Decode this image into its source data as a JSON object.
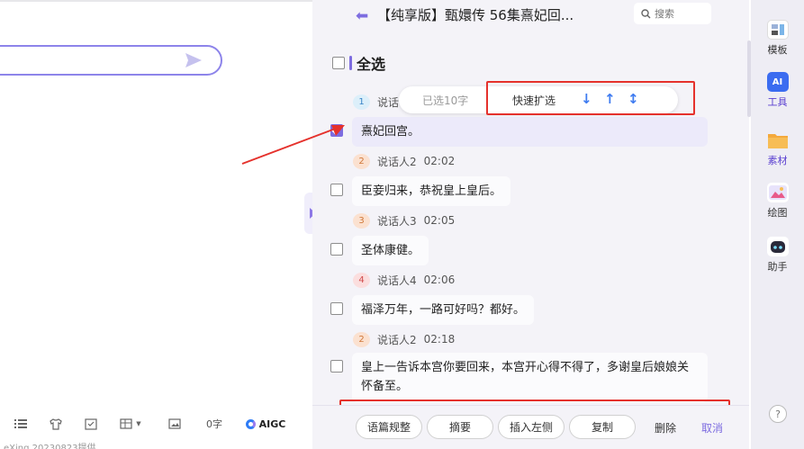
{
  "header": {
    "back_icon": "back-arrow-icon",
    "title": "【纯享版】甄嬛传 56集熹妃回...",
    "search_placeholder": "搜索"
  },
  "select_all_label": "全选",
  "selection_bar": {
    "selected_text": "已选10字",
    "expand_label": "快速扩选",
    "icons": [
      "arrow-down-icon",
      "arrow-up-icon",
      "arrow-updown-icon"
    ]
  },
  "utterances": [
    {
      "badge": "1",
      "speaker": "说话",
      "time": "",
      "text": "熹妃回宫。",
      "checked": true
    },
    {
      "badge": "2",
      "speaker": "说话人2",
      "time": "02:02",
      "text": "臣妾归来，恭祝皇上皇后。",
      "checked": false
    },
    {
      "badge": "3",
      "speaker": "说话人3",
      "time": "02:05",
      "text": "圣体康健。",
      "checked": false
    },
    {
      "badge": "4",
      "speaker": "说话人4",
      "time": "02:06",
      "text": "福泽万年，一路可好吗？都好。",
      "checked": false
    },
    {
      "badge": "2",
      "speaker": "说话人2",
      "time": "02:18",
      "text": "皇上一告诉本宫你要回来，本宫开心得不得了，多谢皇后娘娘关怀备至。",
      "checked": false
    }
  ],
  "badge_colors": {
    "1": "#dceffa",
    "2": "#fbe1d0",
    "3": "#fbe1d0",
    "4": "#fbdede"
  },
  "badge_text_colors": {
    "1": "#3a86c8",
    "2": "#d0783a",
    "3": "#d0783a",
    "4": "#d04a4a"
  },
  "actions": {
    "format": "语篇规整",
    "summary": "摘要",
    "insert_left": "插入左侧",
    "copy": "复制",
    "delete": "删除",
    "cancel": "取消"
  },
  "left_toolbar": {
    "word_count": "0字",
    "aigc_label": "AIGC",
    "footer_text": "eXing 20230823提供"
  },
  "rail": [
    {
      "icon": "template-icon",
      "label": "模板"
    },
    {
      "icon": "ai-tools-icon",
      "label": "工具",
      "icon_text": "AI"
    },
    {
      "icon": "material-folder-icon",
      "label": "素材"
    },
    {
      "icon": "drawing-icon",
      "label": "绘图"
    },
    {
      "icon": "assistant-robot-icon",
      "label": "助手"
    }
  ],
  "help_label": "?",
  "colors": {
    "accent": "#7d6ce0",
    "highlight_red": "#e5312c",
    "link_blue": "#3e7bf0"
  }
}
